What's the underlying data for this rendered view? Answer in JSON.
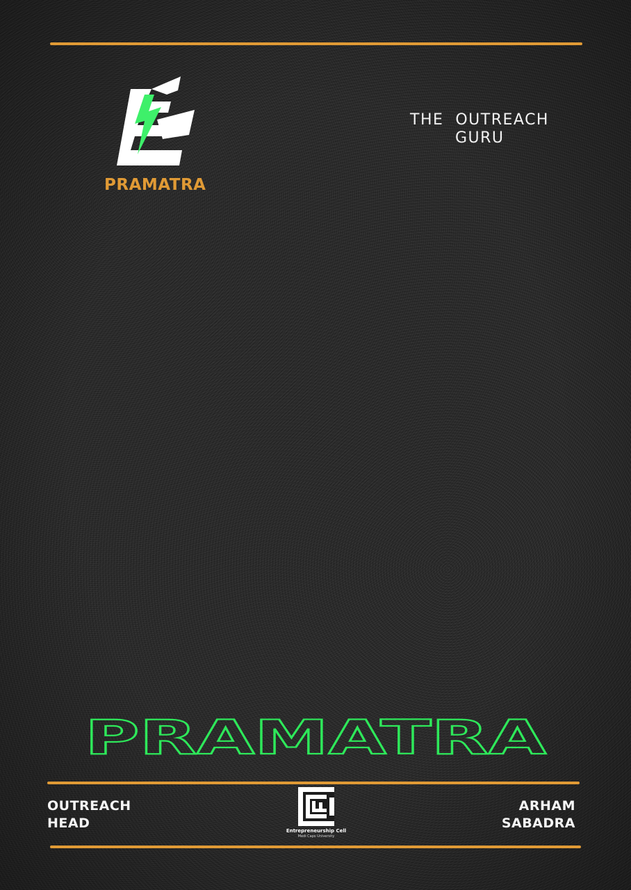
{
  "colors": {
    "rule": "#e09a35",
    "brand_text": "#e09a35",
    "title_outline": "#2ee85a",
    "bolt": "#3ef06a",
    "text": "#f2f2f2"
  },
  "brand": {
    "logo_icon": "lightning-e-logo-icon",
    "name": "PRAMATRA"
  },
  "tagline": {
    "line1": "THE  OUTREACH",
    "line2": "GURU"
  },
  "title": "PRAMATRA",
  "footer": {
    "role_line1": "OUTREACH",
    "role_line2": "HEAD",
    "name_line1": "ARHAM",
    "name_line2": "SABADRA",
    "org_logo_icon": "e-cell-logo-icon",
    "org_name": "Entrepreneurship Cell",
    "org_sub": "Medi Caps University"
  }
}
